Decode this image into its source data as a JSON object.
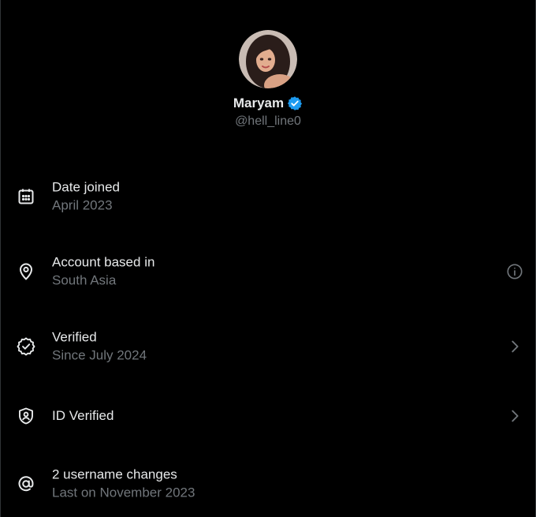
{
  "profile": {
    "display_name": "Maryam",
    "handle": "@hell_line0",
    "verified_badge_color": "#1d9bf0"
  },
  "about_rows": [
    {
      "icon": "calendar-icon",
      "title": "Date joined",
      "subtitle": "April 2023",
      "trailing": ""
    },
    {
      "icon": "location-pin-icon",
      "title": "Account based in",
      "subtitle": "South Asia",
      "trailing": "info-icon"
    },
    {
      "icon": "verified-check-icon",
      "title": "Verified",
      "subtitle": "Since July 2024",
      "trailing": "chevron-right-icon"
    },
    {
      "icon": "id-shield-icon",
      "title": "ID Verified",
      "subtitle": "",
      "trailing": "chevron-right-icon"
    },
    {
      "icon": "at-sign-icon",
      "title": "2 username changes",
      "subtitle": "Last on November 2023",
      "trailing": ""
    }
  ],
  "colors": {
    "background": "#000000",
    "primary_text": "#e7e9ea",
    "secondary_text": "#71767b",
    "accent": "#1d9bf0"
  }
}
